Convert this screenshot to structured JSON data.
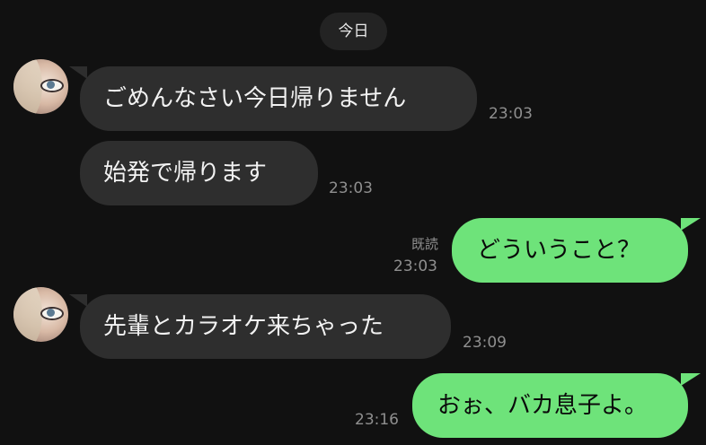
{
  "date_separator": "今日",
  "messages": [
    {
      "side": "incoming",
      "text": "ごめんなさい今日帰りません",
      "time": "23:03"
    },
    {
      "side": "incoming",
      "text": "始発で帰ります",
      "time": "23:03"
    },
    {
      "side": "outgoing",
      "text": "どういうこと？",
      "time": "23:03",
      "read_label": "既読"
    },
    {
      "side": "incoming",
      "text": "先輩とカラオケ来ちゃった",
      "time": "23:09"
    },
    {
      "side": "outgoing",
      "text": "おぉ、バカ息子よ。",
      "time": "23:16"
    }
  ],
  "colors": {
    "background": "#111111",
    "incoming_bubble": "#2e2e2e",
    "outgoing_bubble": "#6ee37a",
    "timestamp": "#8f8f8f"
  }
}
